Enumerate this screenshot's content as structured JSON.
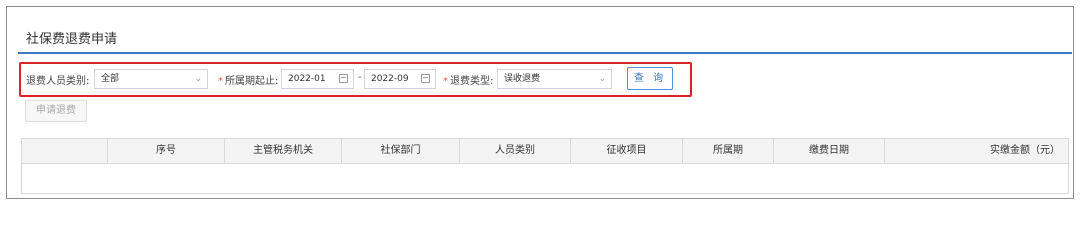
{
  "panel": {
    "title": "社保费退费申请"
  },
  "filters": {
    "person_type": {
      "label": "退费人员类别:",
      "value": "全部"
    },
    "period": {
      "label": "所属期起止:",
      "start": "2022-01",
      "end": "2022-09",
      "separator": "-"
    },
    "refund_type": {
      "label": "退费类型:",
      "value": "误收退费"
    },
    "query_label": "查 询"
  },
  "actions": {
    "apply_refund_label": "申请退费"
  },
  "table": {
    "columns": [
      "",
      "序号",
      "主管税务机关",
      "社保部门",
      "人员类别",
      "征收项目",
      "所属期",
      "缴费日期",
      "实缴金额（元）"
    ]
  },
  "colors": {
    "accent": "#3a78c3",
    "highlight": "#d7262b",
    "required": "#e05a4c"
  }
}
